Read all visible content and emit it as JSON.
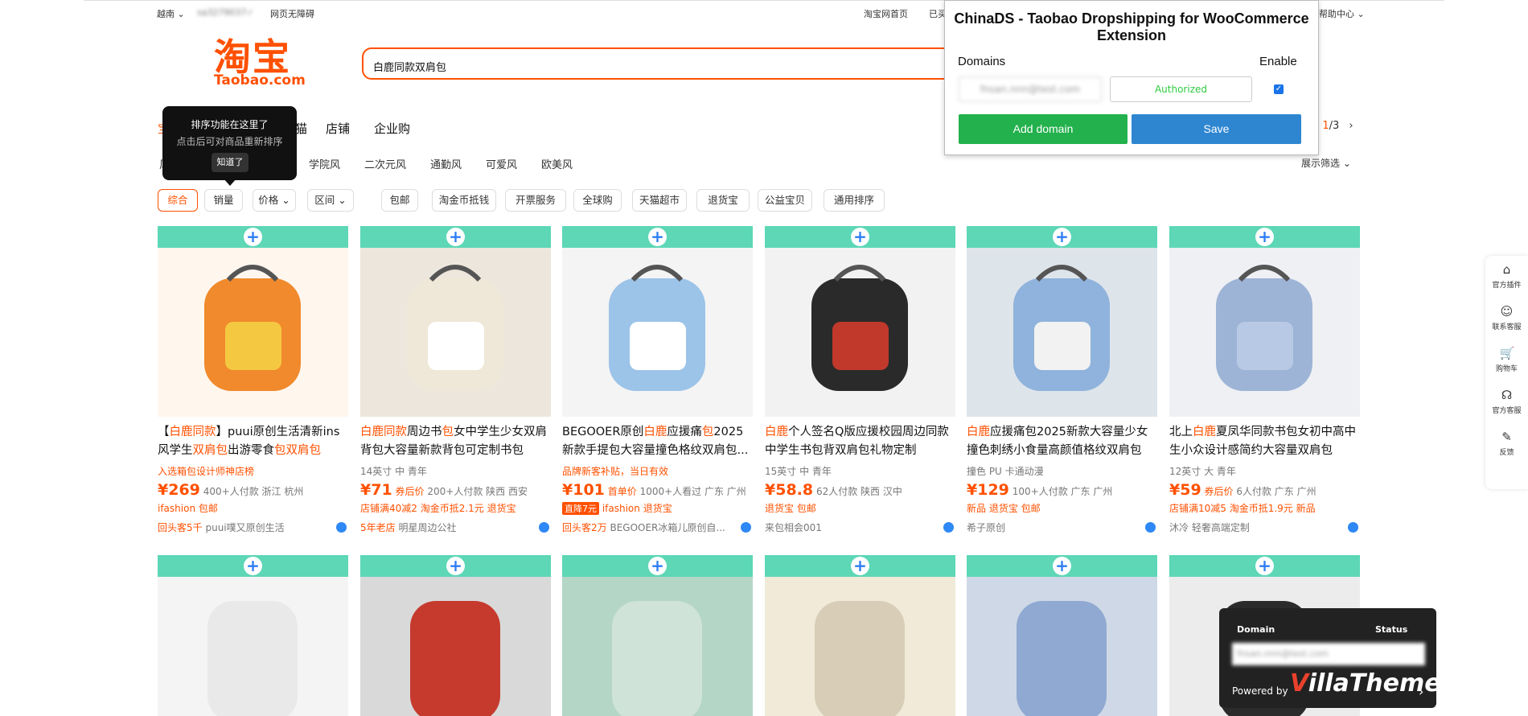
{
  "topbar": {
    "region": "越南",
    "account": "sa3279037✓",
    "accessibility": "网页无障碍",
    "home": "淘宝网首页",
    "bought": "已买",
    "help": "帮助中心"
  },
  "logo": {
    "cn": "淘宝",
    "en": "Taobao.com"
  },
  "search": {
    "value": "白鹿同款双肩包"
  },
  "nav_tabs": [
    "宝贝",
    "天猫",
    "店铺",
    "企业购"
  ],
  "tooltip": {
    "title": "排序功能在这里了",
    "desc": "点击后可对商品重新排序",
    "button": "知道了"
  },
  "styles": [
    "学院风",
    "二次元风",
    "通勤风",
    "可爱风",
    "欧美风"
  ],
  "pager": {
    "current": "1",
    "total": "/3"
  },
  "show_filter": "展示筛选",
  "filters": [
    {
      "label": "综合",
      "active": true
    },
    {
      "label": "销量"
    },
    {
      "label": "价格 ⌄"
    },
    {
      "label": "区间 ⌄"
    },
    {
      "label": "包邮"
    },
    {
      "label": "淘金币抵钱"
    },
    {
      "label": "开票服务"
    },
    {
      "label": "全球购"
    },
    {
      "label": "天猫超市"
    },
    {
      "label": "退货宝"
    },
    {
      "label": "公益宝贝"
    },
    {
      "label": "通用排序"
    }
  ],
  "products": [
    {
      "t1": "【",
      "h1": "白鹿同款",
      "t2": "】puui原创生活清新ins风学生",
      "h2": "双肩包",
      "t3": "出游零食",
      "h3": "包双肩包",
      "promo": "入选箱包设计师神店榜",
      "price": "269",
      "price_note": "",
      "sales": "400+人付款  浙江 杭州",
      "tags": "ifashion  包邮",
      "shop_pre": "回头客5千",
      "shop": "puui噗又原创生活",
      "img_color": "#fff6ee"
    },
    {
      "t1": "",
      "h1": "白鹿同款",
      "t2": "周边书",
      "h2": "包",
      "t3": "女中学生少女双肩",
      "h3": "",
      "t4": "背包大容量新款背包可定制书包",
      "specs": "14英寸  中  青年",
      "price": "71",
      "price_note": "券后价",
      "sales": "200+人付款  陕西 西安",
      "tags": "店铺满40减2  淘金币抵2.1元  退货宝",
      "shop_pre": "5年老店",
      "shop": "明星周边公社",
      "img_color": "#ece6dc"
    },
    {
      "t1": "BEGOOER原创",
      "h1": "白鹿",
      "t2": "应援痛",
      "h2": "包",
      "t3": "2025新款手提包大容量撞色格纹双肩包...",
      "h3": "",
      "promo": "品牌新客补贴，当日有效",
      "price": "101",
      "price_note": "首单价",
      "sales": "1000+人看过  广东 广州",
      "tags": "ifashion  退货宝",
      "tag_box": "直降7元",
      "shop_pre": "回头客2万",
      "shop": "BEGOOER冰箱儿原创自...",
      "img_color": "#f4f4f4"
    },
    {
      "t1": "",
      "h1": "白鹿",
      "t2": "个人签名Q版应援校园周边同款中学生书包背双肩包礼物定制",
      "h2": "",
      "t3": "",
      "h3": "",
      "specs": "15英寸  中  青年",
      "price": "58.8",
      "price_note": "",
      "sales": "62人付款  陕西 汉中",
      "tags": "退货宝  包邮",
      "shop_pre": "",
      "shop": "来包相会001",
      "img_color": "#f2f2f2"
    },
    {
      "t1": "",
      "h1": "白鹿",
      "t2": "应援痛包2025新款大容量少女撞色刺绣小食量高颜值格纹双肩包",
      "h2": "",
      "t3": "",
      "h3": "",
      "specs": "撞色  PU  卡通动漫",
      "price": "129",
      "price_note": "",
      "sales": "100+人付款  广东 广州",
      "tags": "新品  退货宝  包邮",
      "shop_pre": "",
      "shop": "希子原创",
      "img_color": "#dde4ea"
    },
    {
      "t1": "北上",
      "h1": "白鹿",
      "t2": "夏凤华同款书包女初中高中生小众设计感简约大容量双肩包",
      "h2": "",
      "t3": "",
      "h3": "",
      "specs": "12英寸  大  青年",
      "price": "59",
      "price_note": "券后价",
      "sales": "6人付款  广东 广州",
      "tags": "店铺满10减5  淘金币抵1.9元  新品",
      "shop_pre": "",
      "shop": "沐冷 轻奢高端定制",
      "img_color": "#eef0f4"
    }
  ],
  "popup": {
    "title": "ChinaDS - Taobao Dropshipping for WooCommerce Extension",
    "domains_label": "Domains",
    "enable_label": "Enable",
    "domain_value": "fnsan.nnn@test.com",
    "status_value": "Authorized",
    "add_domain": "Add domain",
    "save": "Save"
  },
  "sidebar": [
    "官方插件",
    "联系客服",
    "购物车",
    "官方客服",
    "反馈"
  ],
  "villa": {
    "domain_label": "Domain",
    "status_label": "Status",
    "domain_value": "fnsan.nnn@test.com",
    "powered": "Powered by",
    "brand": "VillaTheme"
  }
}
